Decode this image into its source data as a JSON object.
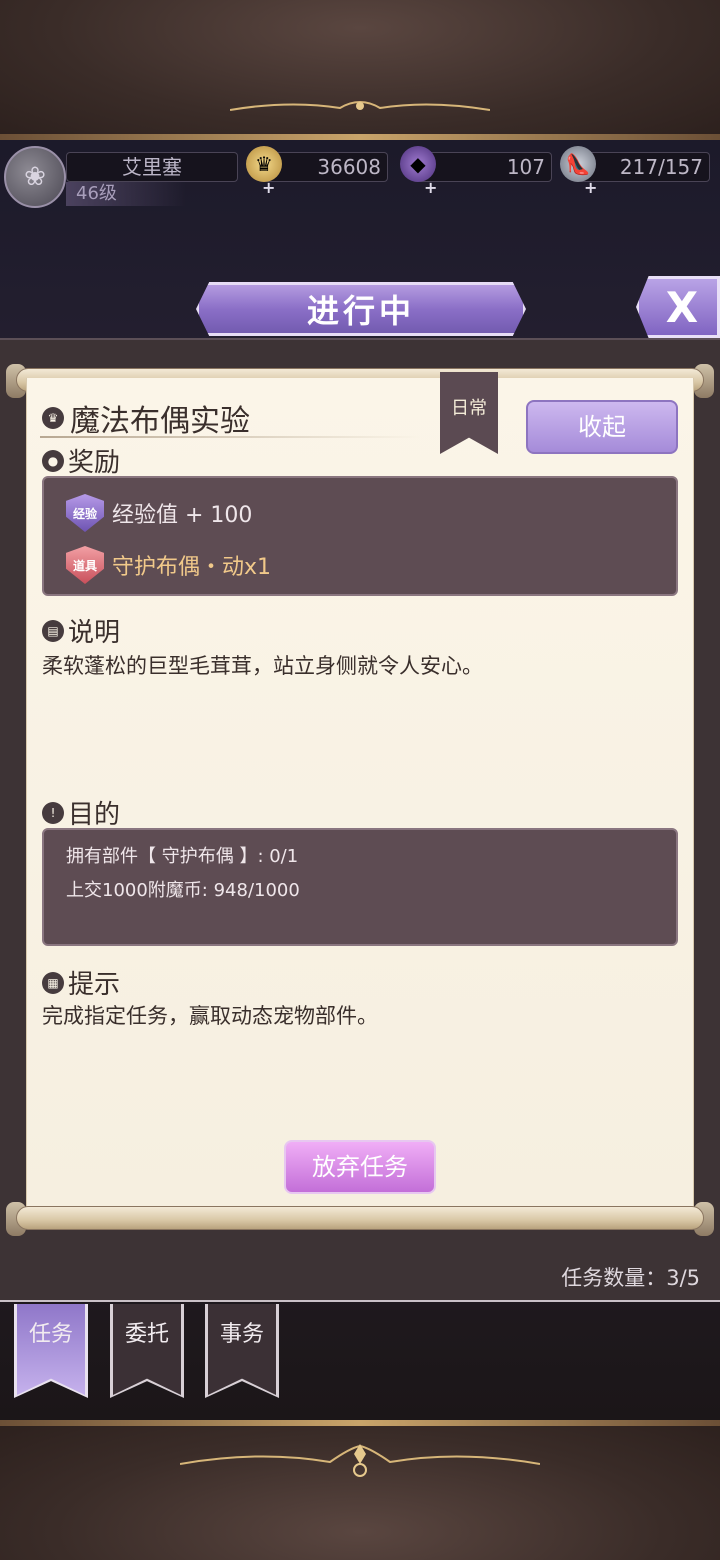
{
  "player": {
    "name": "艾里塞",
    "level": "46级",
    "gold": "36608",
    "gems": "107",
    "stamina": "217/157"
  },
  "header": {
    "title": "进行中",
    "close_label": "X"
  },
  "quest": {
    "title": "魔法布偶实验",
    "tag": "日常",
    "collapse_label": "收起",
    "reward_heading": "奖励",
    "rewards": [
      {
        "badge": "经验",
        "text": "经验值 + 100",
        "color": "#efe6ea"
      },
      {
        "badge": "道具",
        "text": "守护布偶・动x1",
        "color": "#f1c98a"
      }
    ],
    "desc_heading": "说明",
    "description": "柔软蓬松的巨型毛茸茸，站立身侧就令人安心。",
    "goal_heading": "目的",
    "objectives": [
      "拥有部件【 守护布偶 】: 0/1",
      "上交1000附魔币: 948/1000"
    ],
    "hint_heading": "提示",
    "hint": "完成指定任务，赢取动态宠物部件。",
    "abandon_label": "放弃任务"
  },
  "footer": {
    "count_text": "任务数量：3/5",
    "tabs": [
      "任务",
      "委托",
      "事务"
    ]
  },
  "colors": {
    "accent_purple": "#8b6fc7",
    "abandon_pink": "#c36fd8",
    "paper": "#fbf5e8"
  }
}
